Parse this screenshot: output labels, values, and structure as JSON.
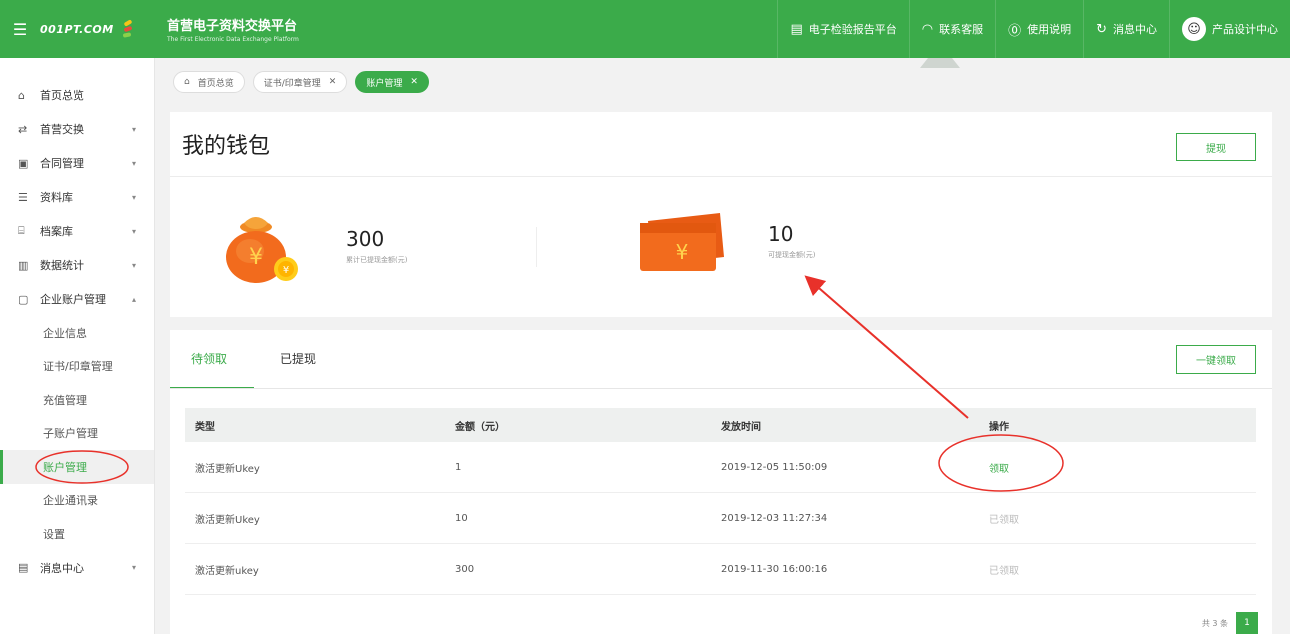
{
  "header": {
    "logo_text": "001PT.COM",
    "title_cn": "首营电子资料交换平台",
    "title_en": "The First Electronic Data Exchange Platform",
    "nav": [
      {
        "icon": "report-icon",
        "label": "电子检验报告平台"
      },
      {
        "icon": "headset-icon",
        "label": "联系客服"
      },
      {
        "icon": "help-icon",
        "label": "使用说明"
      },
      {
        "icon": "bell-icon",
        "label": "消息中心"
      },
      {
        "icon": "avatar-icon",
        "label": "产品设计中心"
      }
    ]
  },
  "sidebar": {
    "items": [
      {
        "icon": "home-icon",
        "label": "首页总览",
        "arrow": ""
      },
      {
        "icon": "exchange-icon",
        "label": "首营交换",
        "arrow": "▾"
      },
      {
        "icon": "contract-icon",
        "label": "合同管理",
        "arrow": "▾"
      },
      {
        "icon": "list-icon",
        "label": "资料库",
        "arrow": "▾"
      },
      {
        "icon": "archive-icon",
        "label": "档案库",
        "arrow": "▾"
      },
      {
        "icon": "chart-icon",
        "label": "数据统计",
        "arrow": "▾"
      },
      {
        "icon": "briefcase-icon",
        "label": "企业账户管理",
        "arrow": "▴"
      }
    ],
    "subitems": [
      "企业信息",
      "证书/印章管理",
      "充值管理",
      "子账户管理",
      "账户管理",
      "企业通讯录",
      "设置"
    ],
    "last_item": {
      "icon": "message-icon",
      "label": "消息中心",
      "arrow": "▾"
    }
  },
  "tabs": [
    {
      "label": "首页总览",
      "closable": false
    },
    {
      "label": "证书/印章管理",
      "closable": true
    },
    {
      "label": "账户管理",
      "closable": true
    }
  ],
  "wallet": {
    "title": "我的钱包",
    "withdraw_button": "提现",
    "stats": [
      {
        "amount": "300",
        "desc": "累计已提现金额(元)"
      },
      {
        "amount": "10",
        "desc": "可提现金额(元)"
      }
    ]
  },
  "rewards": {
    "tabs": [
      "待领取",
      "已提现"
    ],
    "claim_all_button": "一键领取",
    "columns": [
      "类型",
      "金额（元）",
      "发放时间",
      "操作"
    ],
    "rows": [
      {
        "type": "激活更新Ukey",
        "amount": "1",
        "time": "2019-12-05 11:50:09",
        "action": "领取"
      },
      {
        "type": "激活更新Ukey",
        "amount": "10",
        "time": "2019-12-03 11:27:34",
        "action": "已领取"
      },
      {
        "type": "激活更新ukey",
        "amount": "300",
        "time": "2019-11-30 16:00:16",
        "action": "已领取"
      }
    ],
    "total_text": "共 3 条",
    "page": "1"
  },
  "colors": {
    "brand": "#3bab4a",
    "annotation": "#e8312a"
  }
}
